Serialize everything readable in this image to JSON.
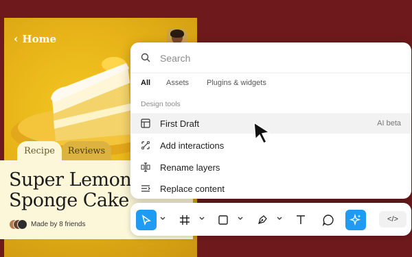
{
  "phone": {
    "back_label": "Home",
    "tabs": [
      {
        "label": "Recipe"
      },
      {
        "label": "Reviews"
      }
    ],
    "title": "Super Lemon Sponge Cake",
    "made_by": "Made by 8 friends"
  },
  "panel": {
    "search_placeholder": "Search",
    "tabs": [
      {
        "label": "All"
      },
      {
        "label": "Assets"
      },
      {
        "label": "Plugins & widgets"
      }
    ],
    "section_label": "Design tools",
    "items": [
      {
        "label": "First Draft",
        "badge": "AI beta",
        "icon": "first-draft-icon"
      },
      {
        "label": "Add interactions",
        "icon": "interactions-icon"
      },
      {
        "label": "Rename layers",
        "icon": "rename-icon"
      },
      {
        "label": "Replace content",
        "icon": "replace-icon"
      }
    ]
  },
  "toolbar": {
    "tools": [
      "move-tool",
      "frame-tool",
      "shape-tool",
      "pen-tool",
      "text-tool",
      "comment-tool",
      "ai-tool",
      "dev-mode"
    ],
    "code_label": "</>"
  },
  "colors": {
    "background": "#6e1a1c",
    "accent": "#1f9cf2",
    "cake_yellow": "#e7b318"
  }
}
